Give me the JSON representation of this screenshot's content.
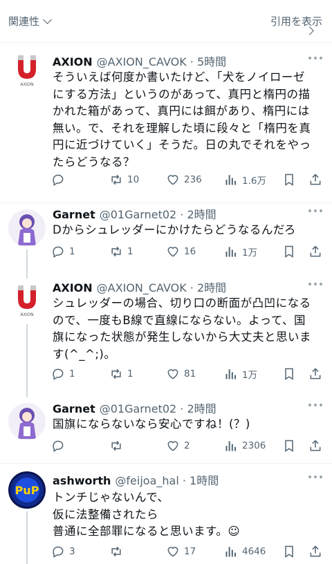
{
  "topbar": {
    "relevance_label": "関連性",
    "quote_label": "引用を表示"
  },
  "tweets": [
    {
      "name": "AXION",
      "meta": "@AXION_CAVOK · 5時間",
      "lines": [
        "そういえば何度か書いたけど、「犬をノイローゼ",
        "にする方法」というのがあって、真円と楕円の描",
        "かれた箱があって、真円には餌があり、楕円には",
        "無い。で、それを理解した頃に段々と「楕円を真",
        "円に近づけていく」そうだ。日の丸でそれをやっ",
        "たらどうなる？"
      ],
      "replies": "",
      "retweets": "10",
      "likes": "236",
      "views": "1.6万"
    },
    {
      "name": "Garnet",
      "meta": "@01Garnet02 · 2時間",
      "lines": [
        "Dからシュレッダーにかけたらどうなるんだろ"
      ],
      "replies": "1",
      "retweets": "1",
      "likes": "16",
      "views": "1万"
    },
    {
      "name": "AXION",
      "meta": "@AXION_CAVOK · 2時間",
      "lines": [
        "シュレッダーの場合、切り口の断面が凸凹になる",
        "ので、一度もB線で直線にならない。よって、国",
        "旗になった状態が発生しないから大丈夫と思いま",
        "す(^_^;)。"
      ],
      "replies": "1",
      "retweets": "1",
      "likes": "81",
      "views": "1万"
    },
    {
      "name": "Garnet",
      "meta": "@01Garnet02 · 2時間",
      "lines": [
        "国旗にならないなら安心ですね！(？)"
      ],
      "replies": "",
      "retweets": "",
      "likes": "2",
      "views": "2306"
    },
    {
      "name": "ashworth",
      "meta": "@feijoa_hal · 1時間",
      "lines": [
        "トンチじゃないんで、",
        "仮に法整備されたら",
        "普通に全部罪になると思います。☺"
      ],
      "replies": "3",
      "retweets": "",
      "likes": "17",
      "views": "4646"
    }
  ],
  "icons": {
    "reply": "reply-icon",
    "retweet": "retweet-icon",
    "like": "heart-icon",
    "views": "views-icon",
    "bookmark": "bookmark-icon",
    "share": "share-icon",
    "more": "more-icon"
  },
  "colors": {
    "text": "#0f1419",
    "secondary": "#536471",
    "divider": "#eff3f4",
    "thread_line": "#cfd9de"
  }
}
